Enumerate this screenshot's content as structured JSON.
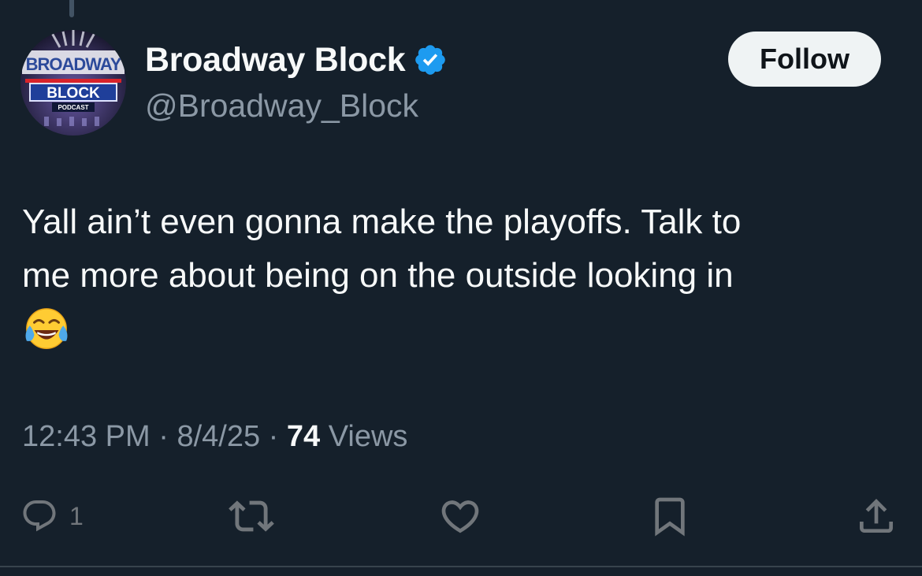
{
  "tweet": {
    "author": {
      "display_name": "Broadway Block",
      "handle": "@Broadway_Block",
      "verified": true,
      "avatar_text": {
        "line1": "BROADWAY",
        "line2": "BLOCK",
        "line3": "PODCAST"
      }
    },
    "follow_label": "Follow",
    "text_line1": "Yall ain’t even gonna make the playoffs. Talk to",
    "text_line2": "me more about being on the outside looking in",
    "emoji": "face-with-tears-of-joy",
    "time": "12:43 PM",
    "date": "8/4/25",
    "views_count": "74",
    "views_label": "Views",
    "separator": "·",
    "actions": {
      "reply_count": "1",
      "icons": [
        "reply-icon",
        "retweet-icon",
        "like-icon",
        "bookmark-icon",
        "share-icon"
      ]
    }
  },
  "colors": {
    "background": "#15202b",
    "text": "#f7f9f9",
    "secondary_text": "#8b98a5",
    "verified_blue": "#1d9bf0",
    "follow_bg": "#eff3f4",
    "icon": "#71767b"
  }
}
